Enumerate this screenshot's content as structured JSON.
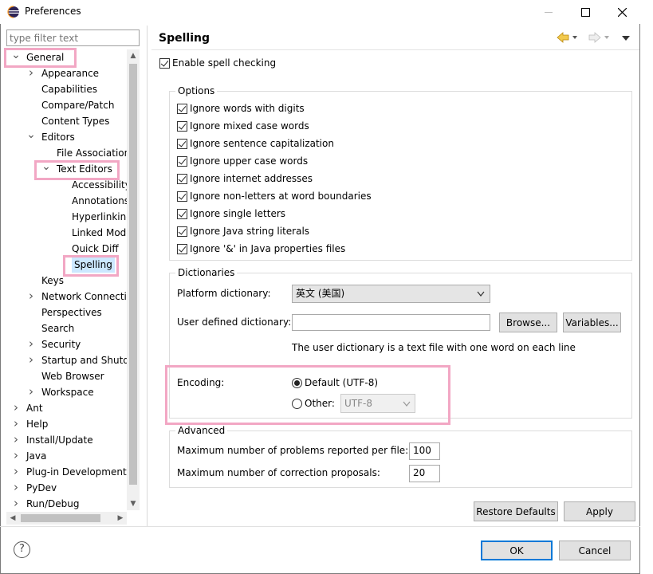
{
  "window": {
    "title": "Preferences"
  },
  "filter": {
    "placeholder": "type filter text"
  },
  "tree": {
    "items": [
      {
        "label": "General",
        "expanded": true
      },
      {
        "label": "Appearance"
      },
      {
        "label": "Capabilities"
      },
      {
        "label": "Compare/Patch"
      },
      {
        "label": "Content Types"
      },
      {
        "label": "Editors",
        "expanded": true
      },
      {
        "label": "File Associations"
      },
      {
        "label": "Text Editors",
        "expanded": true
      },
      {
        "label": "Accessibility"
      },
      {
        "label": "Annotations"
      },
      {
        "label": "Hyperlinking"
      },
      {
        "label": "Linked Mode"
      },
      {
        "label": "Quick Diff"
      },
      {
        "label": "Spelling",
        "selected": true
      },
      {
        "label": "Keys"
      },
      {
        "label": "Network Connections"
      },
      {
        "label": "Perspectives"
      },
      {
        "label": "Search"
      },
      {
        "label": "Security"
      },
      {
        "label": "Startup and Shutdown"
      },
      {
        "label": "Web Browser"
      },
      {
        "label": "Workspace"
      },
      {
        "label": "Ant"
      },
      {
        "label": "Help"
      },
      {
        "label": "Install/Update"
      },
      {
        "label": "Java"
      },
      {
        "label": "Plug-in Development"
      },
      {
        "label": "PyDev"
      },
      {
        "label": "Run/Debug"
      }
    ]
  },
  "page": {
    "title": "Spelling",
    "enable_label": "Enable spell checking",
    "options": {
      "title": "Options",
      "items": [
        "Ignore words with digits",
        "Ignore mixed case words",
        "Ignore sentence capitalization",
        "Ignore upper case words",
        "Ignore internet addresses",
        "Ignore non-letters at word boundaries",
        "Ignore single letters",
        "Ignore Java string literals",
        "Ignore '&' in Java properties files"
      ]
    },
    "dictionaries": {
      "title": "Dictionaries",
      "platform_label": "Platform dictionary:",
      "platform_value": "英文 (美国)",
      "user_label": "User defined dictionary:",
      "user_value": "",
      "browse_label": "Browse...",
      "variables_label": "Variables...",
      "hint": "The user dictionary is a text file with one word on each line",
      "encoding_label": "Encoding:",
      "default_label": "Default (UTF-8)",
      "other_label": "Other:",
      "other_value": "UTF-8"
    },
    "advanced": {
      "title": "Advanced",
      "max_problems_label": "Maximum number of problems reported per file:",
      "max_problems_value": "100",
      "max_proposals_label": "Maximum number of correction proposals:",
      "max_proposals_value": "20"
    },
    "restore_label": "Restore Defaults",
    "apply_label": "Apply"
  },
  "footer": {
    "help": "?",
    "ok_label": "OK",
    "cancel_label": "Cancel"
  },
  "colors": {
    "highlight": "#f2a7c4",
    "selection": "#cce8ff",
    "primary_border": "#0078d7"
  }
}
